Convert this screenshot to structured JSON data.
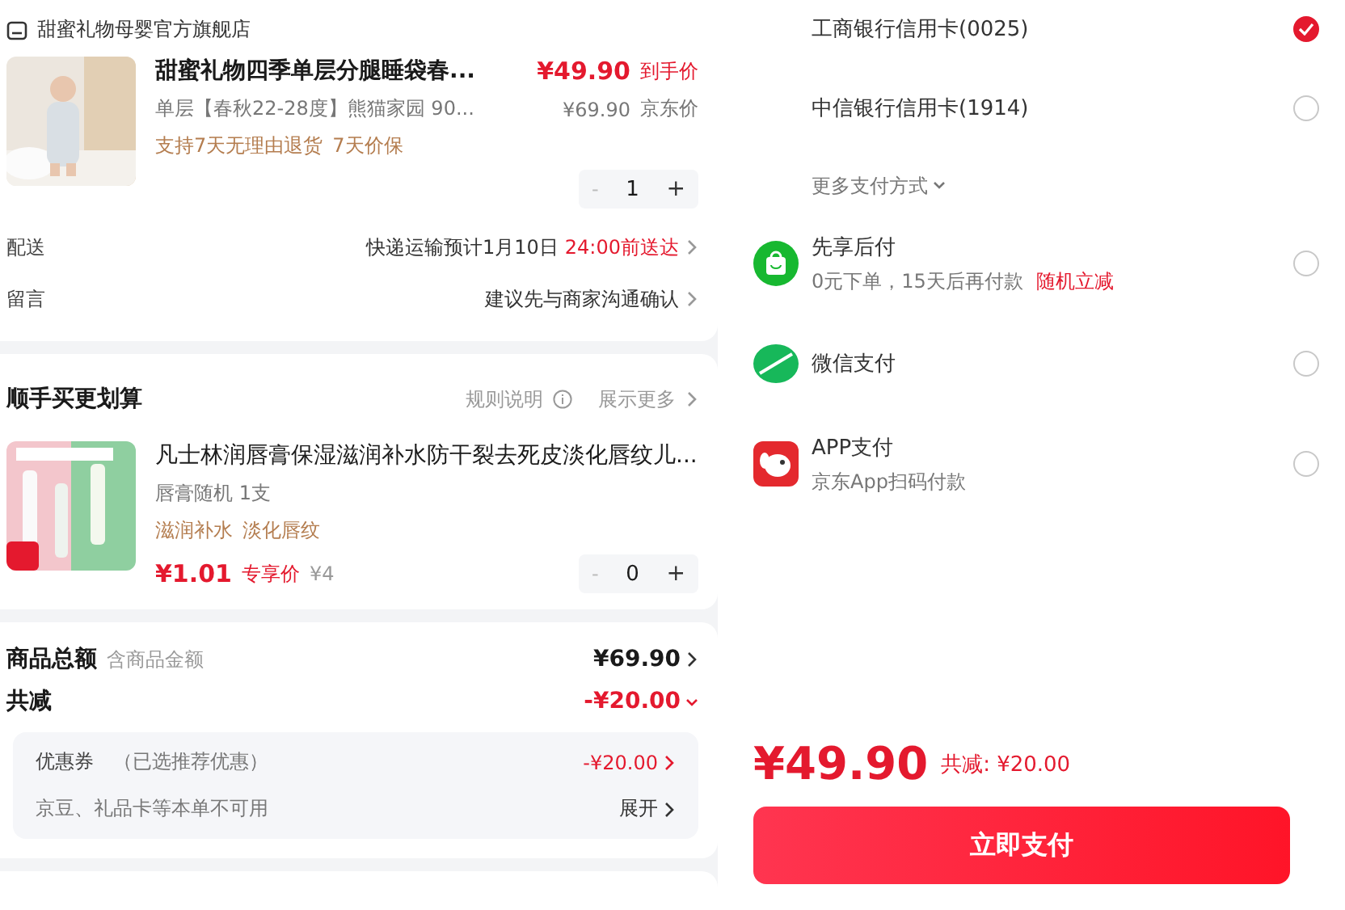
{
  "store": {
    "name": "甜蜜礼物母婴官方旗舰店"
  },
  "product": {
    "title": "甜蜜礼物四季单层分腿睡袋春...",
    "spec": "单层【春秋22-28度】熊猫家园  90...",
    "tags": [
      "支持7天无理由退货",
      "7天价保"
    ],
    "price": "¥49.90",
    "price_label": "到手价",
    "jd_price": "¥69.90",
    "jd_label": "京东价",
    "quantity": "1",
    "minus": "-",
    "plus": "+"
  },
  "order_rows": [
    {
      "label": "配送",
      "value": "快递运输预计1月10日",
      "highlight": "24:00前送达"
    },
    {
      "label": "留言",
      "value": "建议先与商家沟通确认",
      "highlight": ""
    }
  ],
  "addon": {
    "title": "顺手买更划算",
    "rule_link": "规则说明",
    "more_link": "展示更多",
    "product": {
      "title": "凡士林润唇膏保湿滋润补水防干裂去死皮淡化唇纹儿...",
      "spec": "唇膏随机 1支",
      "tags": [
        "滋润补水",
        "淡化唇纹"
      ],
      "price": "¥1.01",
      "price_label": "专享价",
      "original_price": "¥4",
      "quantity": "0",
      "minus": "-",
      "plus": "+"
    }
  },
  "summary": {
    "total_label": "商品总额",
    "total_note": "含商品金额",
    "total_value": "¥69.90",
    "discount_label": "共减",
    "discount_value": "-¥20.00",
    "expanded": true,
    "coupon": {
      "label": "优惠券",
      "note": "（已选推荐优惠）",
      "value": "-¥20.00"
    },
    "unavailable": {
      "label": "京豆、礼品卡等本单不可用",
      "action": "展开"
    }
  },
  "payment": {
    "methods": [
      {
        "kind": "card",
        "name": "工商银行信用卡(0025)",
        "selected": true
      },
      {
        "kind": "card",
        "name": "中信银行信用卡(1914)",
        "selected": false
      },
      {
        "kind": "more",
        "name": "更多支付方式"
      },
      {
        "kind": "later",
        "name": "先享后付",
        "sub": "0元下单，15天后再付款",
        "sub_highlight": "随机立减",
        "selected": false
      },
      {
        "kind": "wechat",
        "name": "微信支付",
        "selected": false
      },
      {
        "kind": "app",
        "name": "APP支付",
        "sub": "京东App扫码付款",
        "selected": false
      }
    ]
  },
  "footer": {
    "price": "¥49.90",
    "saved": "共减: ¥20.00",
    "pay_button": "立即支付"
  }
}
